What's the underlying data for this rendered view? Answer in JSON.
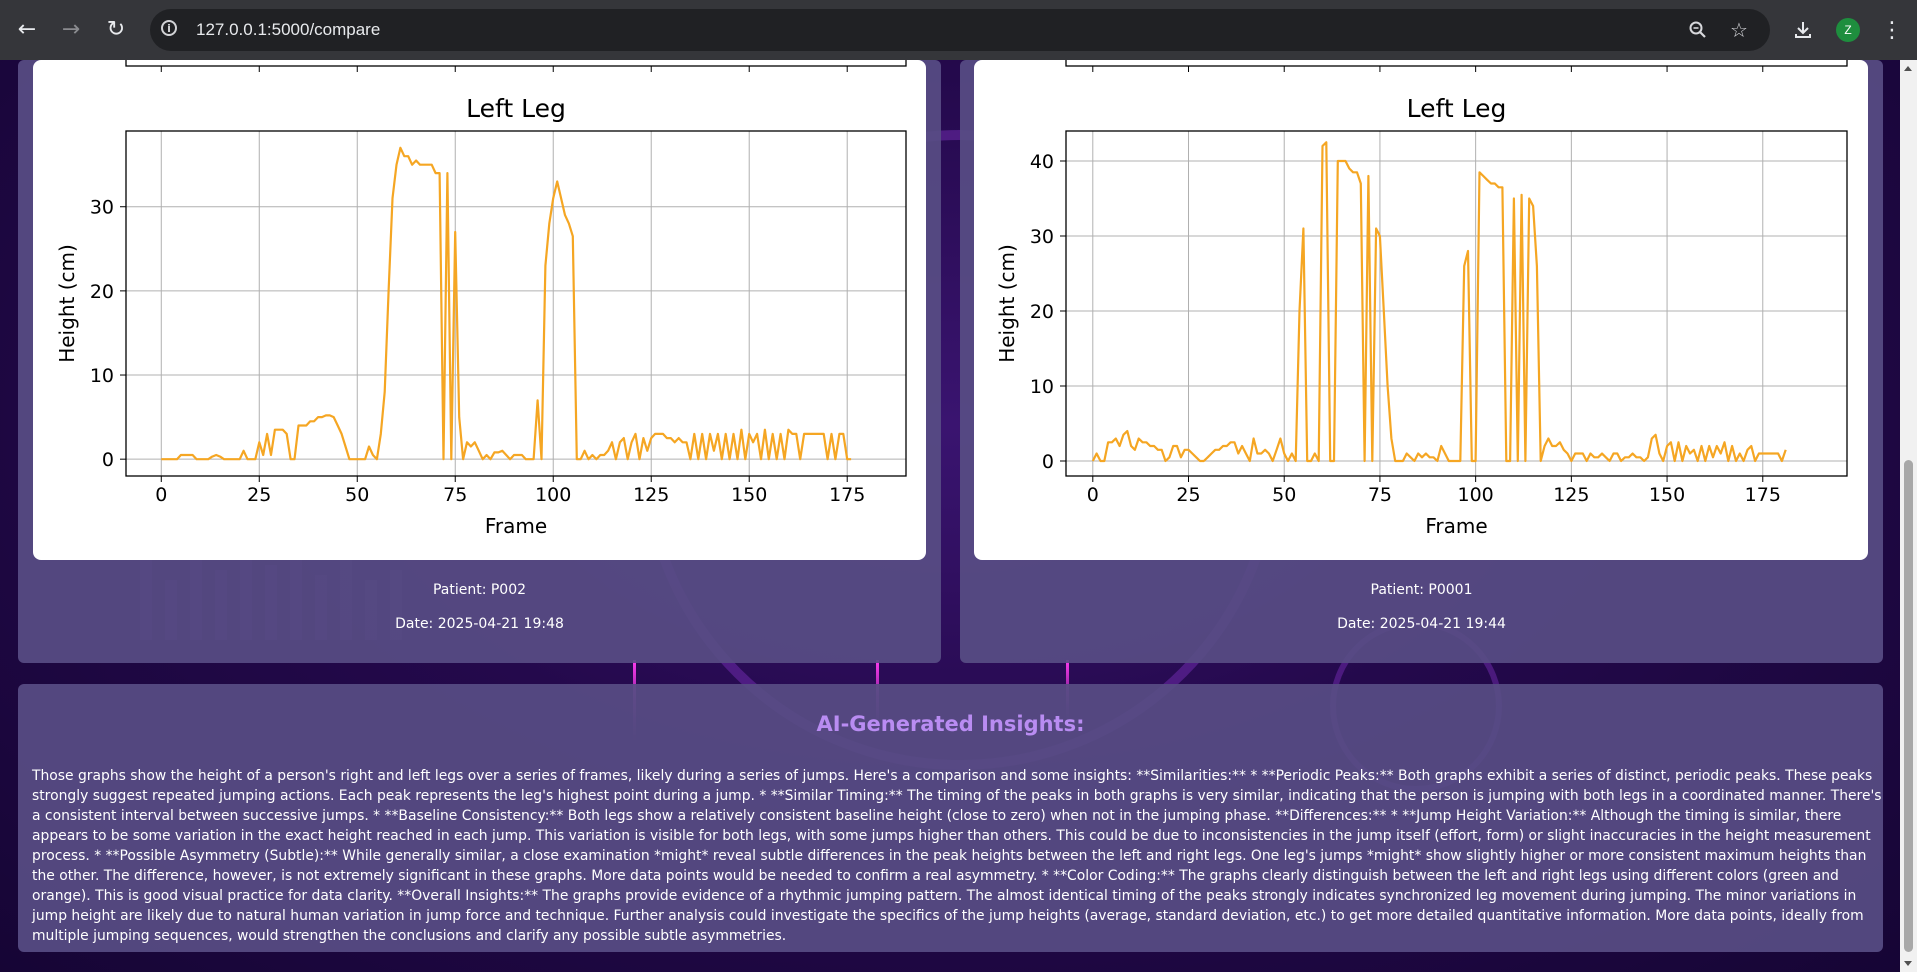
{
  "browser": {
    "url": "127.0.0.1:5000/compare",
    "profile_initial": "Z",
    "icons": [
      "back-arrow-icon",
      "forward-arrow-icon",
      "reload-icon",
      "site-info-icon",
      "zoom-icon",
      "bookmark-star-icon",
      "download-icon",
      "menu-dots-icon"
    ]
  },
  "colors": {
    "line": "#f5a623",
    "card": "#584d84",
    "insights_title": "#b98cf2"
  },
  "left_card": {
    "patient": "Patient: P002",
    "date": "Date: 2025-04-21 19:48"
  },
  "right_card": {
    "patient": "Patient: P0001",
    "date": "Date: 2025-04-21 19:44"
  },
  "insights": {
    "title": "AI-Generated Insights:",
    "text": "Those graphs show the height of a person's right and left legs over a series of frames, likely during a series of jumps. Here's a comparison and some insights: **Similarities:** * **Periodic Peaks:** Both graphs exhibit a series of distinct, periodic peaks. These peaks strongly suggest repeated jumping actions. Each peak represents the leg's highest point during a jump. * **Similar Timing:** The timing of the peaks in both graphs is very similar, indicating that the person is jumping with both legs in a coordinated manner. There's a consistent interval between successive jumps. * **Baseline Consistency:** Both legs show a relatively consistent baseline height (close to zero) when not in the jumping phase. **Differences:** * **Jump Height Variation:** Although the timing is similar, there appears to be some variation in the exact height reached in each jump. This variation is visible for both legs, with some jumps higher than others. This could be due to inconsistencies in the jump itself (effort, form) or slight inaccuracies in the height measurement process. * **Possible Asymmetry (Subtle):** While generally similar, a close examination *might* reveal subtle differences in the peak heights between the left and right legs. One leg's jumps *might* show slightly higher or more consistent maximum heights than the other. The difference, however, is not extremely significant in these graphs. More data points would be needed to confirm a real asymmetry. * **Color Coding:** The graphs clearly distinguish between the left and right legs using different colors (green and orange). This is good visual practice for data clarity. **Overall Insights:** The graphs provide evidence of a rhythmic jumping pattern. The almost identical timing of the peaks strongly indicates synchronized leg movement during jumping. The minor variations in jump height are likely due to natural human variation in jump force and technique. Further analysis could investigate the specifics of the jump heights (average, standard deviation, etc.) to get more detailed quantitative information. More data points, ideally from multiple jumping sequences, would strengthen the conclusions and clarify any possible subtle asymmetries."
  },
  "chart_data": [
    {
      "type": "line",
      "title": "Left Leg",
      "xlabel": "Frame",
      "ylabel": "Height (cm)",
      "xlim": [
        -9,
        190
      ],
      "ylim": [
        -2,
        39
      ],
      "xticks": [
        0,
        25,
        50,
        75,
        100,
        125,
        150,
        175
      ],
      "yticks": [
        0,
        10,
        20,
        30
      ],
      "grid": true,
      "color": "#f5a623",
      "x": [
        0,
        4,
        5,
        8,
        9,
        12,
        13,
        14,
        15,
        16,
        18,
        19,
        20,
        21,
        22,
        24,
        25,
        26,
        27,
        28,
        29,
        30,
        31,
        32,
        33,
        34,
        35,
        36,
        37,
        38,
        39,
        40,
        41,
        42,
        43,
        44,
        45,
        46,
        47,
        48,
        49,
        50,
        51,
        52,
        53,
        54,
        55,
        56,
        57,
        58,
        59,
        60,
        61,
        62,
        63,
        64,
        65,
        66,
        67,
        68,
        69,
        70,
        71,
        72,
        73,
        74,
        75,
        76,
        77,
        78,
        79,
        80,
        81,
        82,
        83,
        84,
        85,
        86,
        87,
        88,
        89,
        90,
        91,
        92,
        93,
        94,
        95,
        96,
        97,
        98,
        99,
        100,
        101,
        102,
        103,
        104,
        105,
        106,
        107,
        108,
        109,
        110,
        111,
        112,
        113,
        114,
        115,
        116,
        117,
        118,
        119,
        120,
        121,
        122,
        123,
        124,
        125,
        126,
        127,
        128,
        129,
        130,
        131,
        132,
        133,
        134,
        135,
        136,
        137,
        138,
        139,
        140,
        141,
        142,
        143,
        144,
        145,
        146,
        147,
        148,
        149,
        150,
        151,
        152,
        153,
        154,
        155,
        156,
        157,
        158,
        159,
        160,
        161,
        162,
        163,
        164,
        165,
        166,
        167,
        168,
        169,
        170,
        171,
        172,
        173,
        174,
        175,
        176,
        177,
        178
      ],
      "y": [
        0,
        0,
        0.5,
        0.5,
        0,
        0,
        0.3,
        0.5,
        0.3,
        0,
        0,
        0,
        0,
        1,
        0,
        0,
        2,
        0.5,
        3,
        0.5,
        3.5,
        3.5,
        3.5,
        3,
        0,
        0,
        4,
        4,
        4,
        4.5,
        4.5,
        5,
        5,
        5.2,
        5.2,
        5,
        4,
        3,
        1.5,
        0,
        0,
        0,
        0,
        0,
        1.5,
        0.5,
        0,
        3,
        8,
        20,
        31,
        35,
        37,
        36,
        36,
        35,
        35.5,
        35,
        35,
        35,
        35,
        34,
        34,
        0,
        34,
        0,
        27,
        5,
        0,
        2,
        1.5,
        2,
        1,
        0,
        0.5,
        0,
        0.8,
        0.8,
        1,
        0.5,
        0,
        0.5,
        0.5,
        0.5,
        0,
        0,
        0,
        7,
        0,
        23,
        28,
        31,
        33,
        31,
        29,
        28,
        26.5,
        0,
        0,
        1,
        0,
        0.5,
        0,
        0.5,
        0.5,
        1,
        2,
        0,
        2,
        2.5,
        0,
        2,
        3,
        0,
        2.5,
        1,
        2.5,
        3,
        3,
        3,
        2.5,
        2.5,
        2,
        2.5,
        2,
        2,
        0,
        3,
        0,
        3,
        0,
        3,
        1,
        3,
        0,
        3,
        0,
        3,
        0,
        3.5,
        0,
        3,
        2,
        3,
        0,
        3.5,
        0,
        3,
        0,
        3,
        0,
        3.5,
        3,
        3,
        0,
        3,
        3,
        3,
        3,
        3,
        3,
        0,
        3,
        0,
        3,
        3,
        0,
        0
      ]
    },
    {
      "type": "line",
      "title": "Left Leg",
      "xlabel": "Frame",
      "ylabel": "Height (cm)",
      "xlim": [
        -7,
        197
      ],
      "ylim": [
        -2,
        44
      ],
      "xticks": [
        0,
        25,
        50,
        75,
        100,
        125,
        150,
        175
      ],
      "yticks": [
        0,
        10,
        20,
        30,
        40
      ],
      "grid": true,
      "color": "#f5a623",
      "x": [
        0,
        1,
        2,
        3,
        4,
        5,
        6,
        7,
        8,
        9,
        10,
        11,
        12,
        13,
        14,
        15,
        16,
        17,
        18,
        19,
        20,
        21,
        22,
        23,
        24,
        25,
        26,
        27,
        28,
        29,
        30,
        31,
        32,
        33,
        34,
        35,
        36,
        37,
        38,
        39,
        40,
        41,
        42,
        43,
        44,
        45,
        46,
        47,
        48,
        49,
        50,
        51,
        52,
        53,
        54,
        55,
        56,
        57,
        58,
        59,
        60,
        61,
        62,
        63,
        64,
        65,
        66,
        67,
        68,
        69,
        70,
        71,
        72,
        73,
        74,
        75,
        76,
        77,
        78,
        79,
        80,
        81,
        82,
        83,
        84,
        85,
        86,
        87,
        88,
        89,
        90,
        91,
        92,
        93,
        94,
        95,
        96,
        97,
        98,
        99,
        100,
        101,
        102,
        103,
        104,
        105,
        106,
        107,
        108,
        109,
        110,
        111,
        112,
        113,
        114,
        115,
        116,
        117,
        118,
        119,
        120,
        121,
        122,
        123,
        124,
        125,
        126,
        127,
        128,
        129,
        130,
        131,
        132,
        133,
        134,
        135,
        136,
        137,
        138,
        139,
        140,
        141,
        142,
        143,
        144,
        145,
        146,
        147,
        148,
        149,
        150,
        151,
        152,
        153,
        154,
        155,
        156,
        157,
        158,
        159,
        160,
        161,
        162,
        163,
        164,
        165,
        166,
        167,
        168,
        169,
        170,
        171,
        172,
        173,
        174,
        175,
        176,
        177,
        178,
        179,
        180,
        181,
        182,
        183,
        184,
        185,
        186,
        187
      ],
      "y": [
        0,
        1,
        0,
        0,
        2.5,
        2.5,
        3,
        2,
        3.5,
        4,
        2,
        1.5,
        3,
        2.5,
        2.5,
        2,
        2,
        1.5,
        1.5,
        0,
        0.5,
        2,
        2,
        0.5,
        1.5,
        1.5,
        1,
        0.5,
        0,
        0,
        0.5,
        1,
        1.5,
        1.5,
        2,
        2,
        2.5,
        2.5,
        1,
        2,
        1,
        0,
        3,
        1,
        1,
        1.5,
        1,
        0,
        1.5,
        3,
        1,
        0,
        1,
        0,
        20,
        31,
        0,
        0,
        1,
        0,
        42,
        42.5,
        0,
        0,
        40,
        40,
        40,
        39,
        38.5,
        38.5,
        37,
        0,
        38,
        0,
        31,
        30,
        20,
        10,
        3,
        0,
        0,
        0,
        1,
        0.5,
        0,
        1,
        0.5,
        1,
        0.5,
        0.5,
        0,
        2,
        1,
        0,
        0,
        0,
        0,
        26,
        28,
        0,
        0,
        38.5,
        38,
        37.5,
        37,
        37,
        36.5,
        36.5,
        0,
        0,
        35,
        0,
        35.5,
        0,
        35,
        34,
        26,
        0,
        2,
        3,
        2,
        2,
        2.5,
        1.5,
        1,
        0,
        1,
        1,
        1,
        0,
        1,
        0.5,
        0.5,
        1,
        0.5,
        0,
        1,
        1,
        0,
        0.5,
        0.5,
        1,
        0.5,
        0.5,
        0,
        0.5,
        3,
        3.5,
        1,
        0,
        2,
        2.5,
        0,
        2.5,
        0,
        2,
        1,
        1.5,
        0,
        2,
        0,
        2,
        0.5,
        2,
        1,
        2.5,
        0,
        2,
        0,
        1,
        0,
        1.5,
        2,
        0,
        1,
        1,
        1,
        1,
        1,
        1,
        0,
        1.5
      ]
    }
  ]
}
